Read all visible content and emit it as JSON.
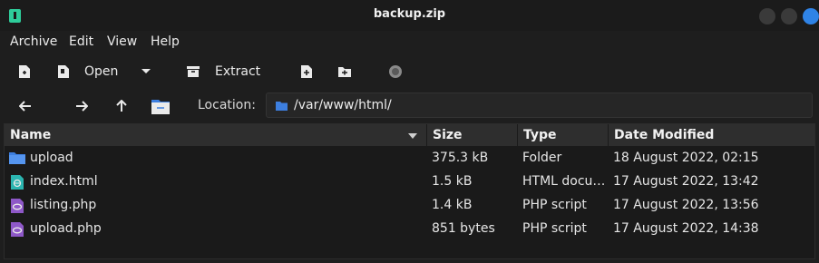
{
  "window": {
    "title": "backup.zip"
  },
  "menu": [
    "Archive",
    "Edit",
    "View",
    "Help"
  ],
  "toolbar": {
    "open_label": "Open",
    "extract_label": "Extract"
  },
  "location": {
    "label": "Location:",
    "path": "/var/www/html/"
  },
  "table": {
    "columns": [
      "Name",
      "Size",
      "Type",
      "Date Modified"
    ],
    "rows": [
      {
        "name": "upload",
        "size": "375.3 kB",
        "type": "Folder",
        "date": "18 August 2022, 02:15",
        "icon": "folder-icon"
      },
      {
        "name": "index.html",
        "size": "1.5 kB",
        "type": "HTML docu…",
        "date": "17 August 2022, 13:42",
        "icon": "html-file-icon"
      },
      {
        "name": "listing.php",
        "size": "1.4 kB",
        "type": "PHP script",
        "date": "17 August 2022, 13:56",
        "icon": "php-file-icon"
      },
      {
        "name": "upload.php",
        "size": "851 bytes",
        "type": "PHP script",
        "date": "17 August 2022, 14:38",
        "icon": "php-file-icon"
      }
    ]
  },
  "colors": {
    "accent": "#2f83e6",
    "folder": "#3d7fe0",
    "html_icon": "#2bb5b0",
    "php_icon": "#8e58c8"
  }
}
